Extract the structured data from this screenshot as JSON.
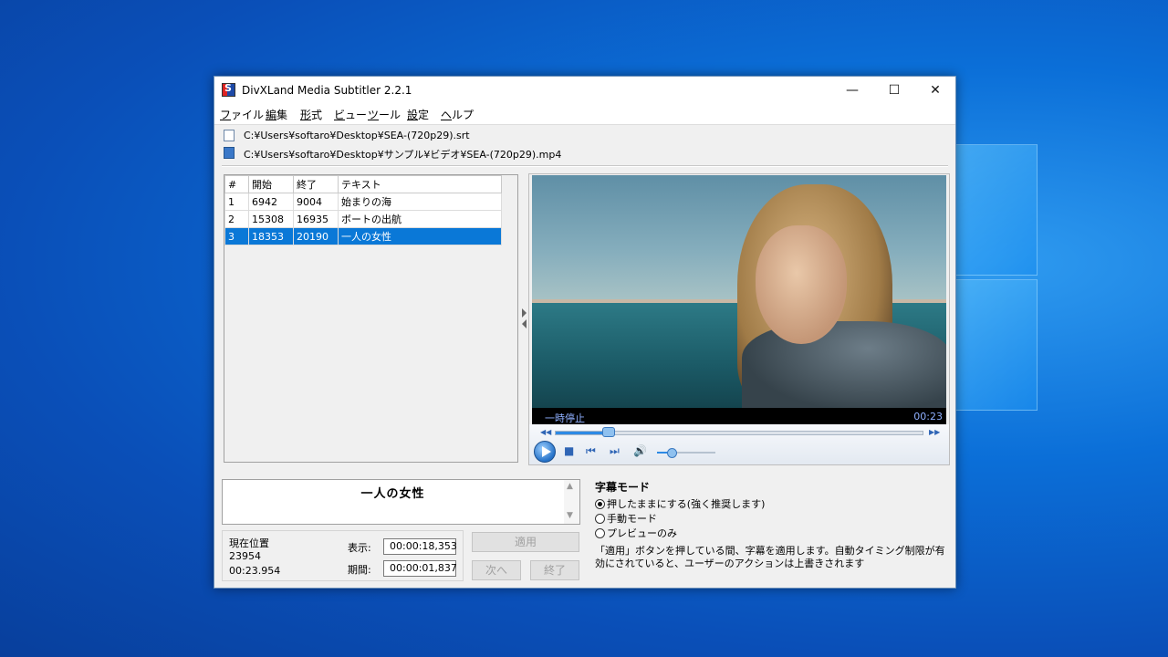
{
  "window": {
    "title": "DivXLand Media Subtitler 2.2.1",
    "controls": {
      "minimize": "—",
      "maximize": "☐",
      "close": "✕"
    }
  },
  "menu": [
    {
      "label": "ファイル",
      "accel": "フ"
    },
    {
      "label": "編集",
      "accel": "編"
    },
    {
      "label": "形式",
      "accel": "形"
    },
    {
      "label": "ビュー",
      "accel": "ビ"
    },
    {
      "label": "ツール",
      "accel": "ツ"
    },
    {
      "label": "設定",
      "accel": "設"
    },
    {
      "label": "ヘルプ",
      "accel": "ヘ"
    }
  ],
  "files": {
    "subtitle_path": "C:¥Users¥softaro¥Desktop¥SEA-(720p29).srt",
    "video_path": "C:¥Users¥softaro¥Desktop¥サンプル¥ビデオ¥SEA-(720p29).mp4"
  },
  "subtitle_table": {
    "headers": [
      "#",
      "開始",
      "終了",
      "テキスト"
    ],
    "rows": [
      {
        "num": "1",
        "start": "6942",
        "end": "9004",
        "text": "始まりの海"
      },
      {
        "num": "2",
        "start": "15308",
        "end": "16935",
        "text": "ボートの出航"
      },
      {
        "num": "3",
        "start": "18353",
        "end": "20190",
        "text": "一人の女性"
      }
    ],
    "selected_index": 2
  },
  "player": {
    "status": "一時停止",
    "time": "00:23",
    "seek_fraction": 0.145,
    "volume_fraction": 0.25
  },
  "editor": {
    "text": "一人の女性"
  },
  "position": {
    "title": "現在位置",
    "ms": "23954",
    "time": "00:23.954",
    "display_label": "表示:",
    "display_value": "00:00:18,353",
    "duration_label": "期間:",
    "duration_value": "00:00:01,837"
  },
  "buttons": {
    "apply": "適用",
    "next": "次へ",
    "end": "終了"
  },
  "mode": {
    "title": "字幕モード",
    "options": [
      "押したままにする(強く推奨します)",
      "手動モード",
      "プレビューのみ"
    ],
    "selected": 0,
    "description": "「適用」ボタンを押している間、字幕を適用します。自動タイミング制限が有効にされていると、ユーザーのアクションは上書きされます"
  },
  "colors": {
    "accent": "#0a78d7",
    "desktop": "#0b6fd8"
  }
}
